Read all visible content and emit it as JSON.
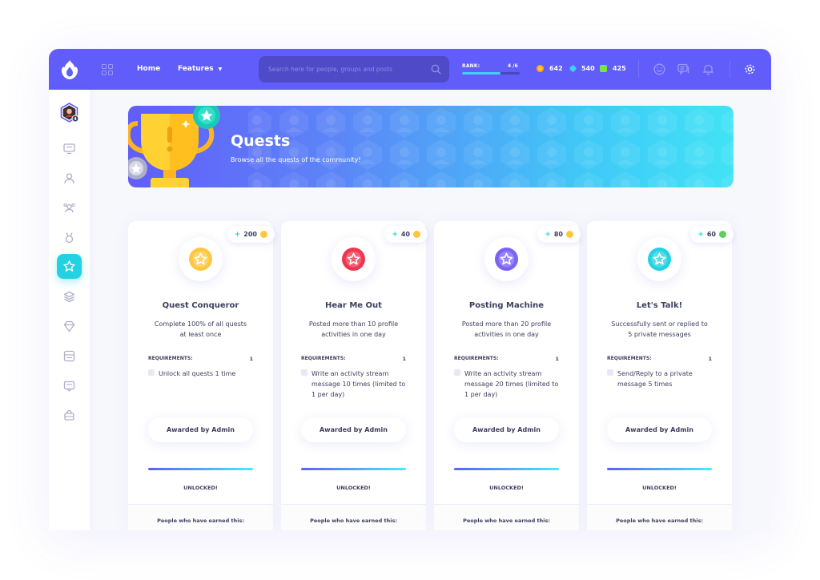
{
  "topbar": {
    "nav_home": "Home",
    "nav_features": "Features",
    "search_placeholder": "Search here for people, groups and posts",
    "rank_label": "RANK:",
    "rank_value": "4 /6",
    "rank_progress": 0.67,
    "currencies": [
      {
        "value": "642",
        "color": "#ffc640"
      },
      {
        "value": "540",
        "color": "#40d0f5"
      },
      {
        "value": "425",
        "color": "#7ae34a"
      }
    ]
  },
  "sidebar": {
    "avatar_badge": "4",
    "items": [
      "newsfeed-icon",
      "profile-icon",
      "groups-icon",
      "badges-icon",
      "quests-icon",
      "streams-icon",
      "events-icon",
      "forums-icon",
      "marketplace-icon",
      "shop-icon"
    ],
    "active": "quests-icon"
  },
  "banner": {
    "title": "Quests",
    "subtitle": "Browse all the quests of the community!"
  },
  "quests": [
    {
      "reward": "200",
      "reward_color": "#ffc640",
      "badge_color": "#ffc640",
      "title": "Quest Conqueror",
      "description": "Complete 100% of all quests at least once",
      "requirements_label": "REQUIREMENTS:",
      "requirements_count": "1",
      "requirement": "Unlock all quests 1 time",
      "award": "Awarded by Admin",
      "status": "UNLOCKED!",
      "footer": "People who have earned this:"
    },
    {
      "reward": "40",
      "reward_color": "#ffc640",
      "badge_color": "#f0354f",
      "title": "Hear Me Out",
      "description": "Posted more than 10 profile activities in one day",
      "requirements_label": "REQUIREMENTS:",
      "requirements_count": "1",
      "requirement": "Write an activity stream message 10 times (limited to 1 per day)",
      "award": "Awarded by Admin",
      "status": "UNLOCKED!",
      "footer": "People who have earned this:"
    },
    {
      "reward": "80",
      "reward_color": "#ffc640",
      "badge_color": "#7b61f5",
      "title": "Posting Machine",
      "description": "Posted more than 20 profile activities in one day",
      "requirements_label": "REQUIREMENTS:",
      "requirements_count": "1",
      "requirement": "Write an activity stream message 20 times (limited to 1 per day)",
      "award": "Awarded by Admin",
      "status": "UNLOCKED!",
      "footer": "People who have earned this:"
    },
    {
      "reward": "60",
      "reward_color": "#59d15a",
      "badge_color": "#23d2e2",
      "title": "Let's Talk!",
      "description": "Successfully sent or replied to 5 private messages",
      "requirements_label": "REQUIREMENTS:",
      "requirements_count": "1",
      "requirement": "Send/Reply to a private message 5 times",
      "award": "Awarded by Admin",
      "status": "UNLOCKED!",
      "footer": "People who have earned this:"
    }
  ]
}
